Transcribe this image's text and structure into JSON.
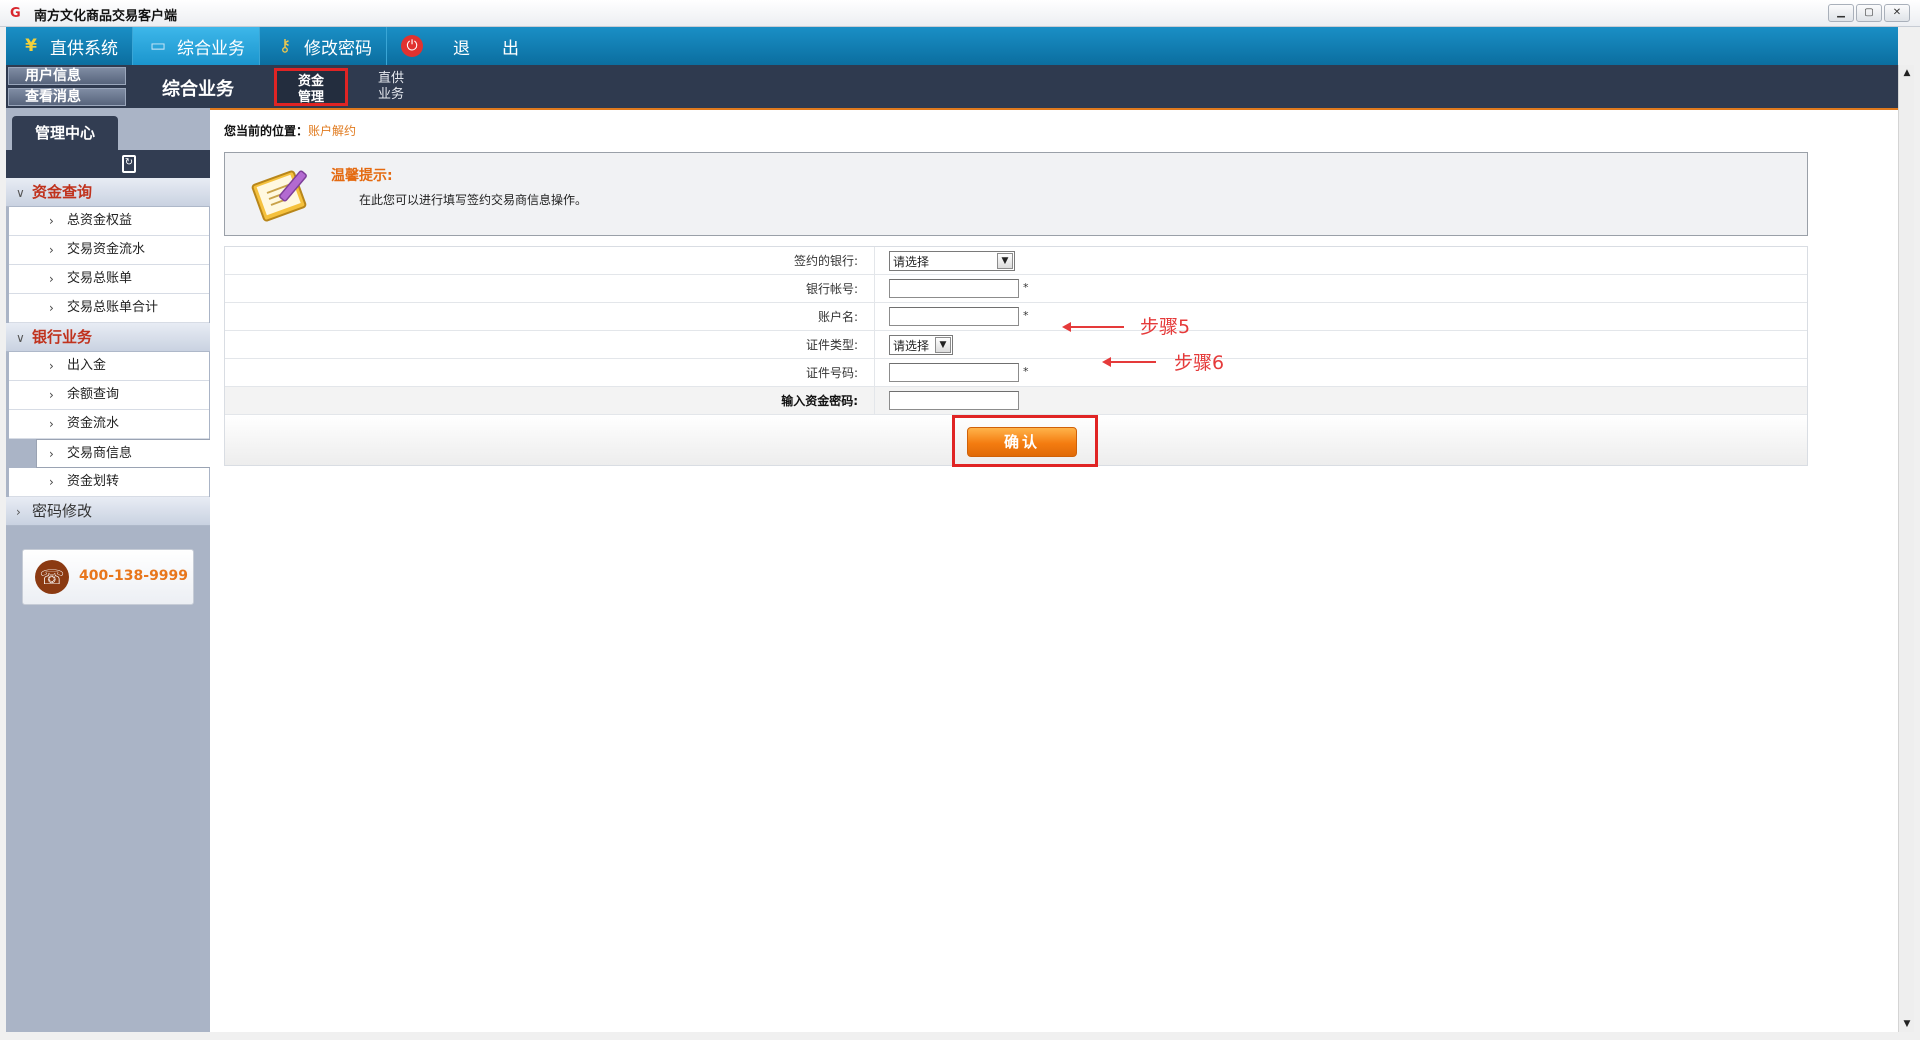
{
  "window": {
    "title": "南方文化商品交易客户端",
    "controls": [
      "minimize",
      "maximize",
      "close"
    ]
  },
  "menubar": {
    "items": [
      {
        "label": "直供系统",
        "icon": "yen-icon"
      },
      {
        "label": "综合业务",
        "icon": "monitor-icon",
        "active": true
      },
      {
        "label": "修改密码",
        "icon": "key-icon"
      },
      {
        "label": "退",
        "icon": "power-icon"
      },
      {
        "label": "出"
      }
    ]
  },
  "subbar": {
    "buttons": [
      "用户信息",
      "查看消息"
    ],
    "section_title": "综合业务",
    "tabs": [
      {
        "line1": "资金",
        "line2": "管理",
        "active": true
      },
      {
        "line1": "直供",
        "line2": "业务"
      }
    ]
  },
  "sidebar": {
    "tab_label": "管理中心",
    "groups": [
      {
        "label": "资金查询",
        "expanded": true,
        "items": [
          "总资金权益",
          "交易资金流水",
          "交易总账单",
          "交易总账单合计"
        ]
      },
      {
        "label": "银行业务",
        "expanded": true,
        "items": [
          "出入金",
          "余额查询",
          "资金流水",
          "交易商信息",
          "资金划转"
        ],
        "selected": "交易商信息"
      },
      {
        "label": "密码修改",
        "expanded": false,
        "items": []
      }
    ],
    "phone": "400-138-9999"
  },
  "content": {
    "breadcrumb_label": "您当前的位置：",
    "breadcrumb_current": "账户解约",
    "tip_title": "温馨提示:",
    "tip_text": "在此您可以进行填写签约交易商信息操作。",
    "form": {
      "bank_label": "签约的银行:",
      "bank_value": "请选择",
      "account_no_label": "银行帐号:",
      "account_no_value": "",
      "account_name_label": "账户名:",
      "account_name_value": "",
      "id_type_label": "证件类型:",
      "id_type_value": "请选择",
      "id_no_label": "证件号码:",
      "id_no_value": "",
      "password_label": "输入资金密码:",
      "password_value": "",
      "required_mark": "*",
      "confirm_label": "确认"
    },
    "annotations": {
      "step5": "步骤5",
      "step6": "步骤6"
    }
  },
  "colors": {
    "menubar": "#0b6e9f",
    "subbar": "#2f3a4f",
    "accent_orange": "#e07a1e",
    "annotation_red": "#e53a3a",
    "group_title_red": "#c0321d"
  }
}
